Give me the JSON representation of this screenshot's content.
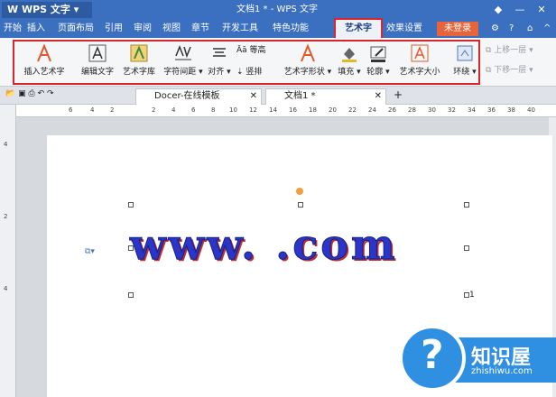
{
  "title_bar": {
    "app_name": "WPS 文字",
    "doc_title": "文档1 * - WPS 文字",
    "minimize": "—",
    "maximize": "□",
    "close": "✕"
  },
  "menu": {
    "items": [
      "开始",
      "插入",
      "页面布局",
      "引用",
      "审阅",
      "视图",
      "章节",
      "开发工具",
      "特色功能"
    ],
    "art_tab": "艺术字",
    "effect_tab": "效果设置",
    "login": "未登录"
  },
  "ribbon": {
    "insert_art": "插入艺术字",
    "edit_text": "编辑文字",
    "art_library": "艺术字库",
    "char_spacing": "字符间距",
    "align": "对齐",
    "equal_height": "等高",
    "vertical": "竖排",
    "art_shape": "艺术字形状",
    "fill": "填充",
    "outline": "轮廓",
    "art_size": "艺术字大小",
    "wrap": "环绕",
    "bring_forward": "上移一层",
    "send_backward": "下移一层"
  },
  "tabs": {
    "template_tab": "Docer-在线模板",
    "doc_tab": "文档1 *",
    "new_tab": "+"
  },
  "ruler": {
    "marks": [
      "6",
      "4",
      "2",
      "2",
      "4",
      "6",
      "8",
      "10",
      "12",
      "14",
      "16",
      "18",
      "20",
      "22",
      "24",
      "26",
      "28",
      "30",
      "32",
      "34",
      "36",
      "38",
      "40"
    ]
  },
  "document": {
    "art_text": "www.   .com",
    "page_marker": "1"
  },
  "watermark": {
    "title": "知识屋",
    "subtitle": "zhishiwu.com",
    "symbol": "?"
  },
  "colors": {
    "accent": "#3b6fbf",
    "highlight_border": "#d8262c",
    "art_fill": "#2a35c9",
    "art_shadow": "#c23030"
  }
}
